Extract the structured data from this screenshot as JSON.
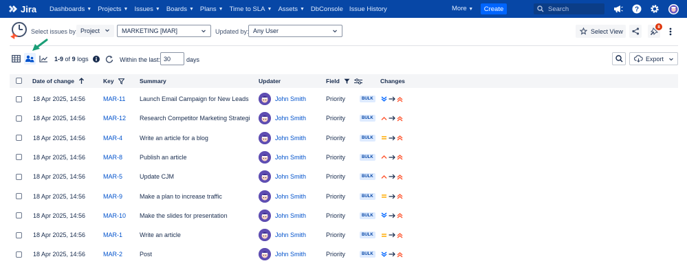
{
  "nav": {
    "logo": "Jira",
    "items": [
      {
        "label": "Dashboards",
        "chevron": true
      },
      {
        "label": "Projects",
        "chevron": true
      },
      {
        "label": "Issues",
        "chevron": true
      },
      {
        "label": "Boards",
        "chevron": true
      },
      {
        "label": "Plans",
        "chevron": true
      },
      {
        "label": "Time to SLA",
        "chevron": true
      },
      {
        "label": "Assets",
        "chevron": true
      },
      {
        "label": "DbConsole",
        "chevron": false
      },
      {
        "label": "Issue History",
        "chevron": false
      }
    ],
    "more": "More",
    "create": "Create",
    "search_placeholder": "Search",
    "bg_color": "#0747a6"
  },
  "filters": {
    "select_issues_by_label": "Select issues by:",
    "select_type": "Project",
    "project_value": "MARKETING [MAR]",
    "updated_by_label": "Updated by:",
    "updated_by_value": "Any User",
    "select_view": "Select View",
    "watch_count": "8"
  },
  "toolbar": {
    "count_range": "1-9",
    "count_of": "of",
    "count_total": "9",
    "count_unit": "logs",
    "within_label": "Within the last:",
    "within_value": "30",
    "within_unit": "days",
    "export_label": "Export"
  },
  "table": {
    "headers": {
      "date": "Date of change",
      "key": "Key",
      "summary": "Summary",
      "updater": "Updater",
      "field": "Field",
      "changes": "Changes"
    },
    "rows": [
      {
        "date": "18 Apr 2025, 14:56",
        "key": "MAR-11",
        "summary": "Launch Email Campaign for New Leads",
        "updater": "John Smith",
        "field": "Priority",
        "bulk": "BULK",
        "from": "lowest",
        "to": "highest"
      },
      {
        "date": "18 Apr 2025, 14:56",
        "key": "MAR-12",
        "summary": "Research Competitor Marketing Strategi…",
        "updater": "John Smith",
        "field": "Priority",
        "bulk": "BULK",
        "from": "high",
        "to": "highest"
      },
      {
        "date": "18 Apr 2025, 14:56",
        "key": "MAR-4",
        "summary": "Write an article for a blog",
        "updater": "John Smith",
        "field": "Priority",
        "bulk": "BULK",
        "from": "medium",
        "to": "highest"
      },
      {
        "date": "18 Apr 2025, 14:56",
        "key": "MAR-8",
        "summary": "Publish an article",
        "updater": "John Smith",
        "field": "Priority",
        "bulk": "BULK",
        "from": "high",
        "to": "highest"
      },
      {
        "date": "18 Apr 2025, 14:56",
        "key": "MAR-5",
        "summary": "Update CJM",
        "updater": "John Smith",
        "field": "Priority",
        "bulk": "BULK",
        "from": "high",
        "to": "highest"
      },
      {
        "date": "18 Apr 2025, 14:56",
        "key": "MAR-9",
        "summary": "Make a plan to increase traffic",
        "updater": "John Smith",
        "field": "Priority",
        "bulk": "BULK",
        "from": "medium",
        "to": "highest"
      },
      {
        "date": "18 Apr 2025, 14:56",
        "key": "MAR-10",
        "summary": "Make the slides for presentation",
        "updater": "John Smith",
        "field": "Priority",
        "bulk": "BULK",
        "from": "lowest",
        "to": "highest"
      },
      {
        "date": "18 Apr 2025, 14:56",
        "key": "MAR-1",
        "summary": "Write an article",
        "updater": "John Smith",
        "field": "Priority",
        "bulk": "BULK",
        "from": "medium",
        "to": "highest"
      },
      {
        "date": "18 Apr 2025, 14:56",
        "key": "MAR-2",
        "summary": "Post",
        "updater": "John Smith",
        "field": "Priority",
        "bulk": "BULK",
        "from": "lowest",
        "to": "highest"
      }
    ]
  },
  "colors": {
    "accent": "#0052cc",
    "priority_high": "#ff5630",
    "priority_medium": "#ffab00",
    "priority_low": "#0065ff",
    "annotation_arrow": "#1b9e77"
  }
}
